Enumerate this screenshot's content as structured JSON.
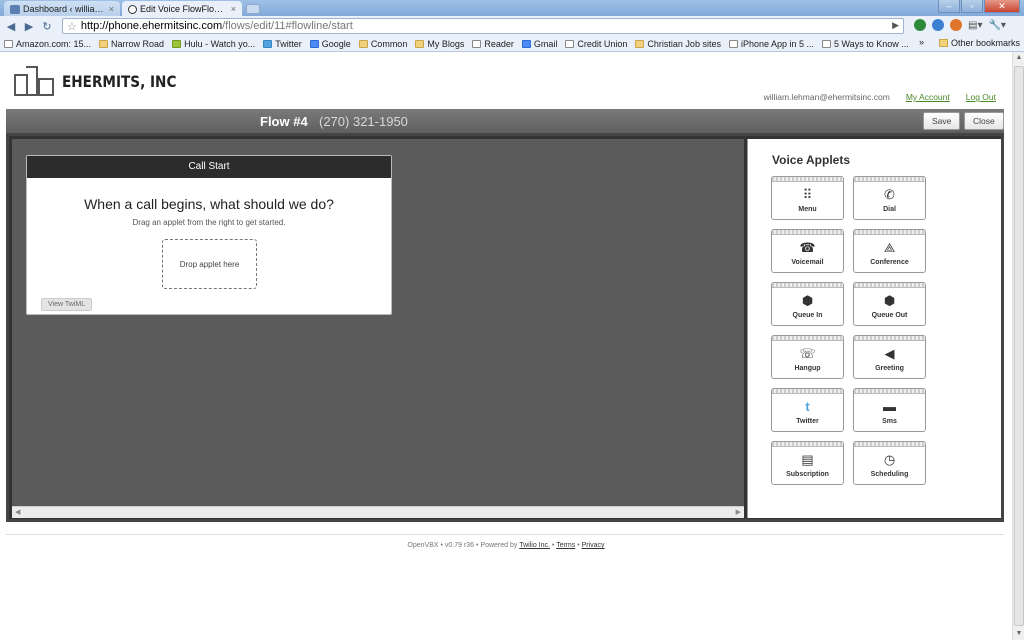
{
  "browser": {
    "tabs": [
      {
        "label": "Dashboard ‹ williaml...",
        "active": false
      },
      {
        "label": "Edit Voice FlowFlow ...",
        "active": true
      }
    ],
    "window_buttons": [
      "–",
      "▫",
      "✕"
    ],
    "url_host": "http://phone.ehermitsinc.com",
    "url_path": "/flows/edit/11#flowline/start",
    "bookmarks": [
      {
        "label": "Amazon.com: 15...",
        "icon": "amazon-icon"
      },
      {
        "label": "Narrow Road",
        "icon": "folder-icon"
      },
      {
        "label": "Hulu - Watch yo...",
        "icon": "hulu-icon"
      },
      {
        "label": "Twitter",
        "icon": "twitter-icon"
      },
      {
        "label": "Google",
        "icon": "google-icon"
      },
      {
        "label": "Common",
        "icon": "folder-icon"
      },
      {
        "label": "My Blogs",
        "icon": "folder-icon"
      },
      {
        "label": "Reader",
        "icon": "reader-icon"
      },
      {
        "label": "Gmail",
        "icon": "gmail-icon"
      },
      {
        "label": "Credit Union",
        "icon": "credit-union-icon"
      },
      {
        "label": "Christian Job sites",
        "icon": "folder-icon"
      },
      {
        "label": "iPhone App in 5 ...",
        "icon": "page-icon"
      },
      {
        "label": "5 Ways to Know ...",
        "icon": "page-icon"
      }
    ],
    "bookmarks_more": "»",
    "other_bookmarks": "Other bookmarks"
  },
  "header": {
    "brand": "EHERMITS, INC",
    "user_email": "william.lehman@ehermitsinc.com",
    "my_account": "My Account",
    "log_out": "Log Out"
  },
  "flowbar": {
    "title": "Flow #4",
    "phone": "(270) 321-1950",
    "save": "Save",
    "close": "Close"
  },
  "card": {
    "header": "Call Start",
    "question": "When a call begins, what should we do?",
    "subtitle": "Drag an applet from the right to get started.",
    "drop_text": "Drop applet here",
    "view_twiml": "View TwiML"
  },
  "panel": {
    "title": "Voice Applets",
    "applets": [
      {
        "label": "Menu",
        "icon": "menu-grid-icon",
        "glyph": "⠿"
      },
      {
        "label": "Dial",
        "icon": "phone-icon",
        "glyph": "✆"
      },
      {
        "label": "Voicemail",
        "icon": "voicemail-icon",
        "glyph": "☎"
      },
      {
        "label": "Conference",
        "icon": "conference-icon",
        "glyph": "⟁"
      },
      {
        "label": "Queue In",
        "icon": "queue-in-icon",
        "glyph": "⬢"
      },
      {
        "label": "Queue Out",
        "icon": "queue-out-icon",
        "glyph": "⬢"
      },
      {
        "label": "Hangup",
        "icon": "hangup-icon",
        "glyph": "☏"
      },
      {
        "label": "Greeting",
        "icon": "greeting-icon",
        "glyph": "◀"
      },
      {
        "label": "Twitter",
        "icon": "twitter-icon",
        "glyph": "t"
      },
      {
        "label": "Sms",
        "icon": "sms-icon",
        "glyph": "▬"
      },
      {
        "label": "Subscription",
        "icon": "subscription-icon",
        "glyph": "▤"
      },
      {
        "label": "Scheduling",
        "icon": "clock-icon",
        "glyph": "◷"
      }
    ]
  },
  "footer": {
    "prefix": "OpenVBX • v0.79 r36 • Powered by",
    "twilio": "Twilio Inc.",
    "sep1": "•",
    "terms": "Terms",
    "sep2": "•",
    "privacy": "Privacy"
  },
  "colors": {
    "flowbar": "#6b6b6b",
    "canvas": "#5b5b5b",
    "card_header": "#2c2c2c",
    "link_green": "#4a8a2a",
    "browser_chrome": "#e9f0f9"
  }
}
